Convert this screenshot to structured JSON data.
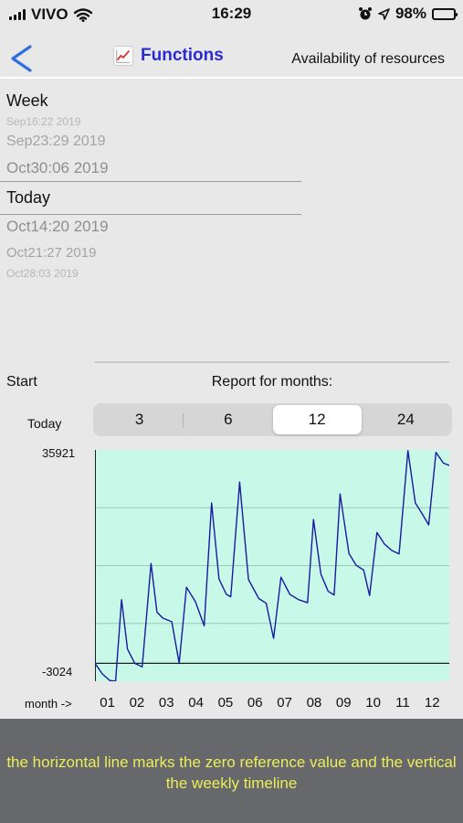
{
  "status": {
    "carrier": "VIVO",
    "time": "16:29",
    "battery": "98%",
    "battery_level": 0.98
  },
  "nav": {
    "back_icon": "chevron-left-icon",
    "title": "Functions",
    "title_icon": "chart-icon",
    "right_label": "Availability of resources"
  },
  "picker": {
    "header_week": "Week",
    "week_items": [
      "Sep16:22 2019",
      "Sep23:29 2019",
      "Oct30:06 2019"
    ],
    "header_today": "Today",
    "today_items": [
      "Oct14:20 2019",
      "Oct21:27 2019",
      "Oct28:03 2019"
    ]
  },
  "controls": {
    "start_label": "Start",
    "report_label": "Report for months:",
    "today_label": "Today",
    "segments": [
      "3",
      "6",
      "12",
      "24"
    ],
    "selected_segment": "12"
  },
  "chart_data": {
    "type": "line",
    "y_max_label": "35921",
    "y_min_label": "-3024",
    "ylim": [
      -3024,
      35921
    ],
    "x_axis_label": "month ->",
    "categories": [
      "01",
      "02",
      "03",
      "04",
      "05",
      "06",
      "07",
      "08",
      "09",
      "10",
      "11",
      "12"
    ],
    "zero_line": true,
    "grid": true,
    "background_color": "#c8f8e8",
    "line_color": "#1a1aa0",
    "series": [
      {
        "x": [
          0.0,
          0.25,
          0.5,
          0.7,
          0.9,
          1.1,
          1.35,
          1.6,
          1.9,
          2.1,
          2.3,
          2.6,
          2.85,
          3.1,
          3.4,
          3.7,
          3.95,
          4.2,
          4.45,
          4.6,
          4.9,
          5.2,
          5.55,
          5.8,
          6.05,
          6.3,
          6.6,
          6.9,
          7.2,
          7.4,
          7.65,
          7.9,
          8.1,
          8.3,
          8.6,
          8.85,
          9.1,
          9.3,
          9.55,
          9.8,
          10.05,
          10.3,
          10.6,
          10.85,
          11.1,
          11.3,
          11.55,
          11.8,
          12.0
        ],
        "y": [
          0,
          -1800,
          -2900,
          -3000,
          10700,
          2400,
          0,
          -600,
          16800,
          8600,
          7600,
          7000,
          0,
          12800,
          10400,
          6300,
          27000,
          14200,
          11600,
          11200,
          30500,
          14100,
          10900,
          10100,
          4200,
          14500,
          11600,
          10700,
          10200,
          24200,
          15000,
          12100,
          11500,
          28500,
          18500,
          16500,
          15700,
          11400,
          22000,
          20100,
          19000,
          18400,
          35800,
          27000,
          25000,
          23300,
          35500,
          33700,
          33300
        ]
      }
    ]
  },
  "caption": "the horizontal line marks the zero reference value and the vertical the weekly timeline"
}
